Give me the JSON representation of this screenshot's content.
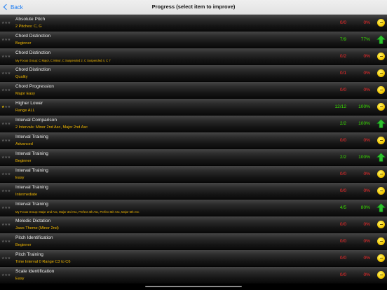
{
  "nav": {
    "back_label": "Back",
    "title": "Progress (select item to improve)"
  },
  "colors": {
    "good": "#39e000",
    "bad": "#ff2a2a",
    "subtitle": "#f2b800",
    "star_on": "#f6c700",
    "star_off": "#666666",
    "back": "#1a7cf5"
  },
  "rows": [
    {
      "title": "Absolute Pitch",
      "subtitle": "2 Pitches: C, G",
      "score": "0/0",
      "percent": "0%",
      "status": "bad",
      "indicator": "neutral-icon",
      "stars": 0
    },
    {
      "title": "Chord Distinction",
      "subtitle": "Beginner",
      "score": "7/9",
      "percent": "77%",
      "status": "good",
      "indicator": "up-arrow-icon",
      "stars": 0
    },
    {
      "title": "Chord Distinction",
      "subtitle": "My Focus Group: C Major, C Minor, C Suspended 2, C Suspended 4, C 7",
      "score": "0/2",
      "percent": "0%",
      "status": "bad",
      "indicator": "neutral-icon",
      "stars": 0
    },
    {
      "title": "Chord Distinction",
      "subtitle": "Quality",
      "score": "0/1",
      "percent": "0%",
      "status": "bad",
      "indicator": "neutral-icon",
      "stars": 0
    },
    {
      "title": "Chord Progression",
      "subtitle": "Major Easy",
      "score": "0/0",
      "percent": "0%",
      "status": "bad",
      "indicator": "neutral-icon",
      "stars": 0
    },
    {
      "title": "Higher Lower",
      "subtitle": "Range ALL",
      "score": "12/12",
      "percent": "100%",
      "status": "good",
      "indicator": "neutral-icon",
      "stars": 1
    },
    {
      "title": "Interval Comparison",
      "subtitle": "2 Intervals: Minor 2nd Asc, Major 2nd Asc",
      "score": "2/2",
      "percent": "100%",
      "status": "good",
      "indicator": "up-arrow-icon",
      "stars": 0
    },
    {
      "title": "Interval Training",
      "subtitle": "Advanced",
      "score": "0/0",
      "percent": "0%",
      "status": "bad",
      "indicator": "neutral-icon",
      "stars": 0
    },
    {
      "title": "Interval Training",
      "subtitle": "Beginner",
      "score": "2/2",
      "percent": "100%",
      "status": "good",
      "indicator": "up-arrow-icon",
      "stars": 0
    },
    {
      "title": "Interval Training",
      "subtitle": "Easy",
      "score": "0/0",
      "percent": "0%",
      "status": "bad",
      "indicator": "neutral-icon",
      "stars": 0
    },
    {
      "title": "Interval Training",
      "subtitle": "Intermediate",
      "score": "0/0",
      "percent": "0%",
      "status": "bad",
      "indicator": "neutral-icon",
      "stars": 0
    },
    {
      "title": "Interval Training",
      "subtitle": "My Focus Group: Major 2nd Asc, Major 3rd Asc, Perfect 4th Asc, Perfect 5th Asc, Major 6th Asc",
      "score": "4/5",
      "percent": "80%",
      "status": "good",
      "indicator": "up-arrow-icon",
      "stars": 0
    },
    {
      "title": "Melodic Dictation",
      "subtitle": "Jaws Theme (Minor 2nd)",
      "score": "0/0",
      "percent": "0%",
      "status": "bad",
      "indicator": "neutral-icon",
      "stars": 0
    },
    {
      "title": "Pitch Identification",
      "subtitle": "Beginner",
      "score": "0/0",
      "percent": "0%",
      "status": "bad",
      "indicator": "neutral-icon",
      "stars": 0
    },
    {
      "title": "Pitch Training",
      "subtitle": "Time Interval 0 Range C3 to C6",
      "score": "0/0",
      "percent": "0%",
      "status": "bad",
      "indicator": "neutral-icon",
      "stars": 0
    },
    {
      "title": "Scale Identification",
      "subtitle": "Easy",
      "score": "0/0",
      "percent": "0%",
      "status": "bad",
      "indicator": "neutral-icon",
      "stars": 0
    }
  ]
}
